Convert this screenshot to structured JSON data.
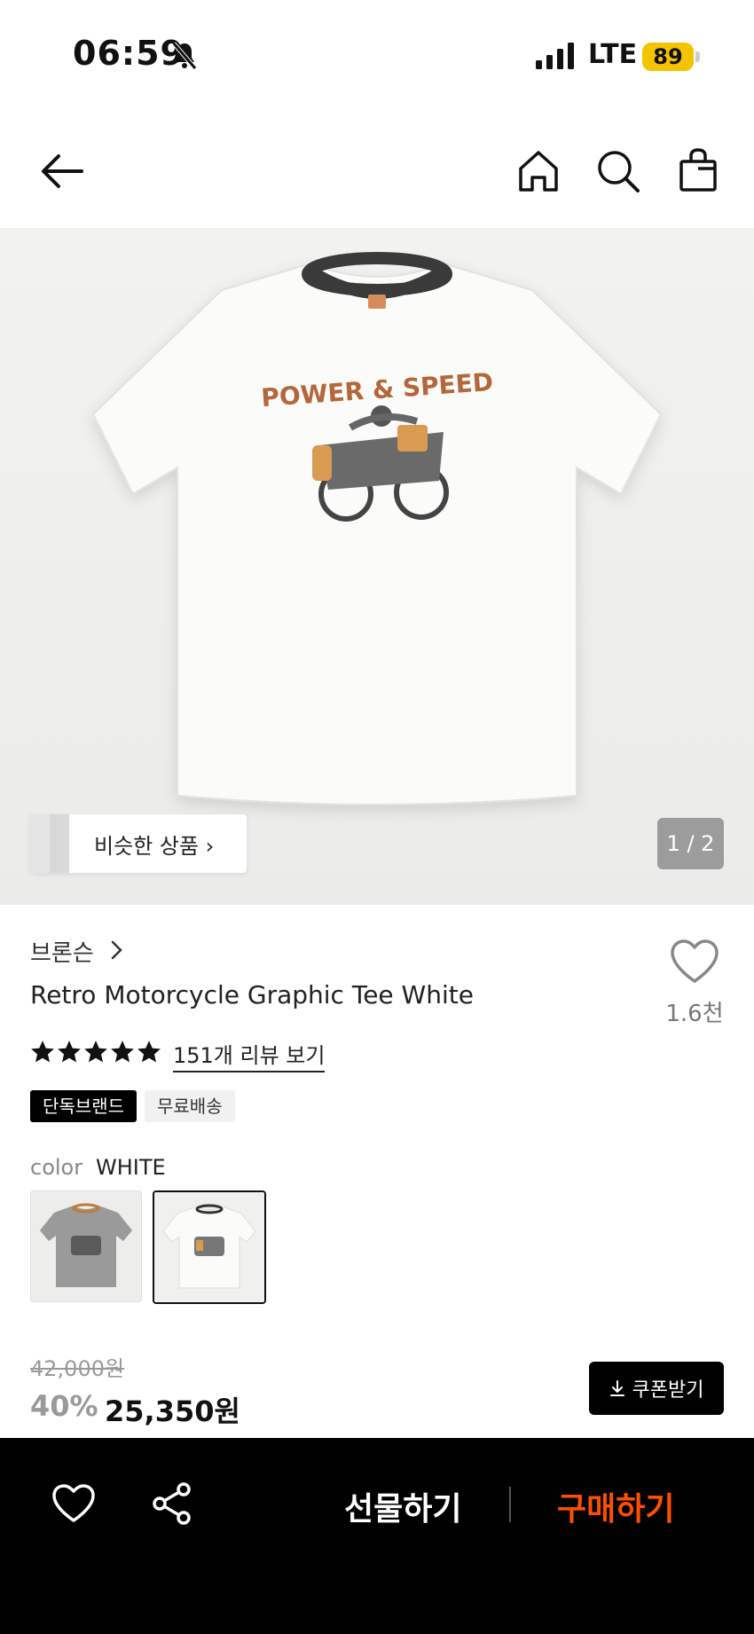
{
  "status_bar": {
    "time": "06:59",
    "network": "LTE",
    "battery": "89"
  },
  "hero": {
    "similar_label": "비슷한 상품",
    "pager": "1 / 2",
    "shirt_print_text": "POWER & SPEED"
  },
  "product": {
    "brand": "브론슨",
    "name": "Retro Motorcycle Graphic Tee White",
    "likes": "1.6천",
    "rating_stars": 5,
    "reviews_link": "151개 리뷰 보기",
    "badges": [
      "단독브랜드",
      "무료배송"
    ],
    "color_label": "color",
    "color_value": "WHITE",
    "swatches": [
      {
        "name": "gray",
        "selected": false
      },
      {
        "name": "white",
        "selected": true
      }
    ]
  },
  "price": {
    "original": "42,000원",
    "discount": "40%",
    "sale": "25,350원",
    "coupon_label": "쿠폰받기"
  },
  "bottom_bar": {
    "gift_label": "선물하기",
    "buy_label": "구매하기"
  },
  "colors": {
    "buy_accent": "#ff4e00",
    "battery": "#f5c400"
  }
}
